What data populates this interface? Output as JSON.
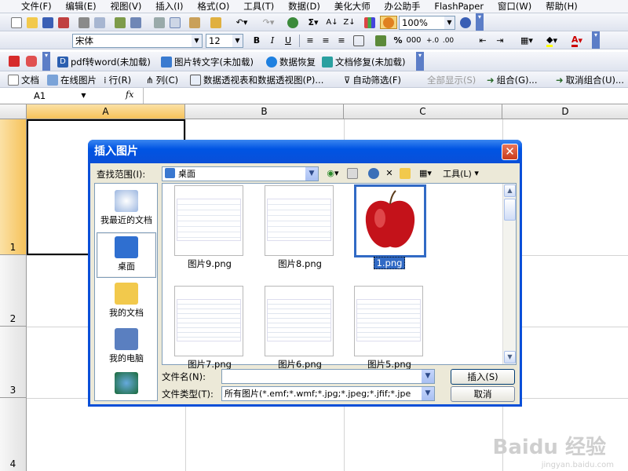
{
  "menu": [
    "文件(F)",
    "编辑(E)",
    "视图(V)",
    "插入(I)",
    "格式(O)",
    "工具(T)",
    "数据(D)",
    "美化大师",
    "办公助手",
    "FlashPaper",
    "窗口(W)",
    "帮助(H)"
  ],
  "toolbar": {
    "zoom": "100%"
  },
  "format": {
    "font": "宋体",
    "size": "12",
    "bold": "B",
    "italic": "I",
    "underline": "U",
    "percent": "%"
  },
  "plugins": [
    {
      "label": "pdf转word(未加载)"
    },
    {
      "label": "图片转文字(未加载)"
    },
    {
      "label": "数据恢复"
    },
    {
      "label": "文档修复(未加载)"
    }
  ],
  "pivot": {
    "doc": "文档",
    "online": "在线图片",
    "row": "行(R)",
    "col": "列(C)",
    "pivot": "数据透视表和数据透视图(P)...",
    "autofilter": "自动筛选(F)",
    "showall": "全部显示(S)",
    "group": "组合(G)...",
    "ungroup": "取消组合(U)..."
  },
  "formula": {
    "cell": "A1",
    "fx": "fx"
  },
  "sheet": {
    "cols": [
      "A",
      "B",
      "C",
      "D"
    ],
    "rows": [
      "1",
      "2",
      "3",
      "4"
    ]
  },
  "dialog": {
    "title": "插入图片",
    "close": "✕",
    "lookin_label": "查找范围(I):",
    "lookin_value": "桌面",
    "tools_label": "工具(L)",
    "places": [
      "我最近的文档",
      "桌面",
      "我的文档",
      "我的电脑",
      ""
    ],
    "files": [
      {
        "name": "图片9.png"
      },
      {
        "name": "图片8.png"
      },
      {
        "name": "1.png"
      },
      {
        "name": "图片7.png"
      },
      {
        "name": "图片6.png"
      },
      {
        "name": "图片5.png"
      }
    ],
    "filename_label": "文件名(N):",
    "filename_value": "",
    "filetype_label": "文件类型(T):",
    "filetype_value": "所有图片(*.emf;*.wmf;*.jpg;*.jpeg;*.jfif;*.jpe",
    "insert": "插入(S)",
    "cancel": "取消",
    "colors": {
      "title": "#0a4fd8",
      "selection": "#316ac5"
    }
  },
  "watermark": {
    "brand": "Baidu 经验",
    "url": "jingyan.baidu.com"
  }
}
